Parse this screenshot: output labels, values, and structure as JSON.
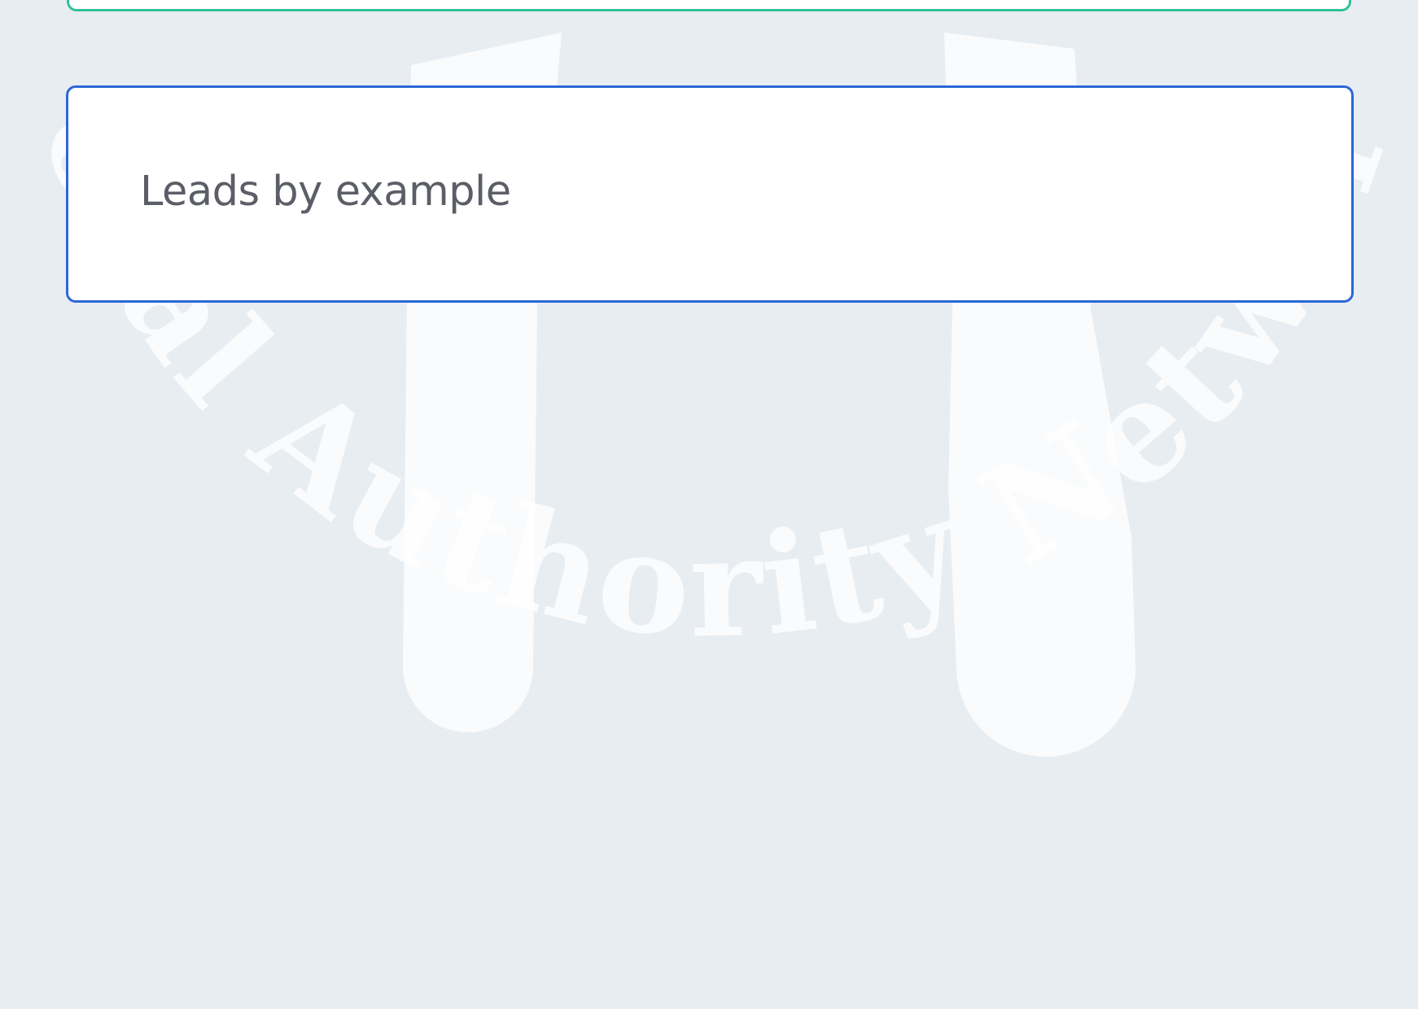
{
  "watermark": {
    "text": "Local Authority Network",
    "color": "#ffffff"
  },
  "options": [
    {
      "label": "",
      "state": "correct",
      "border_color": "#2fc19a"
    },
    {
      "label": "Leads by example",
      "state": "selected",
      "border_color": "#2b67d8"
    }
  ]
}
